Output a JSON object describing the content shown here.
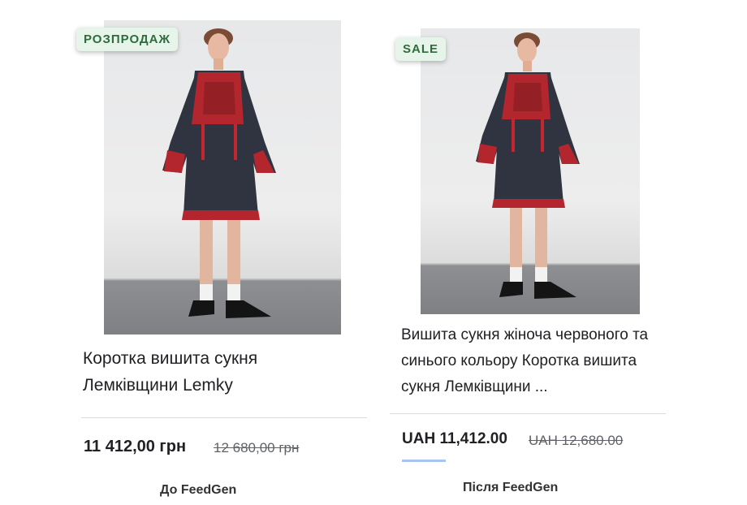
{
  "before": {
    "badge": "РОЗПРОДАЖ",
    "title": "Коротка вишита сукня Лемківщини Lemky",
    "price": "11 412,00 грн",
    "old_price": "12 680,00 грн",
    "caption": "До FeedGen"
  },
  "after": {
    "badge": "SALE",
    "title": "Вишита сукня жіноча червоного та синього кольору Коротка вишита сукня Лемківщини ...",
    "price": "UAH 11,412.00",
    "old_price": "UAH 12,680.00",
    "caption": "Після FeedGen"
  },
  "colors": {
    "badge_bg": "#e6f4ea",
    "badge_text": "#2f6b3c",
    "dress": "#2f3440",
    "embroidery": "#b3262e"
  }
}
